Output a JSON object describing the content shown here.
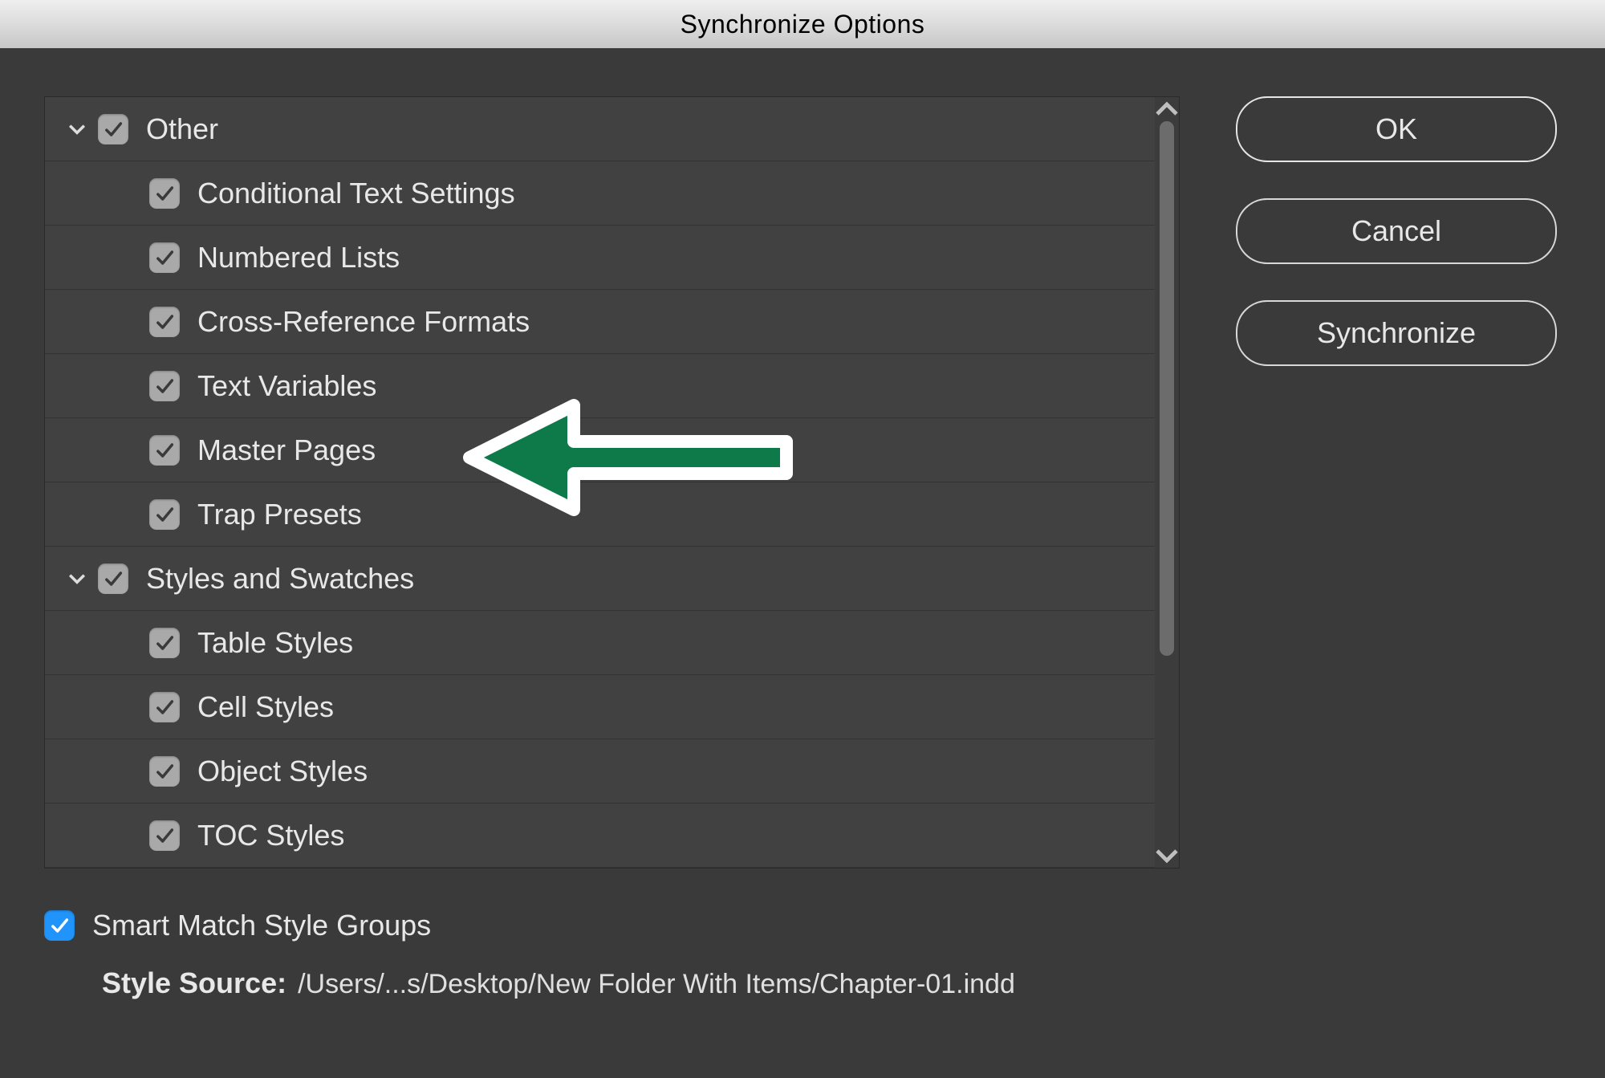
{
  "title": "Synchronize Options",
  "buttons": {
    "ok": "OK",
    "cancel": "Cancel",
    "sync": "Synchronize"
  },
  "groups": [
    {
      "label": "Other",
      "checked": true,
      "items": [
        {
          "label": "Conditional Text Settings",
          "checked": true
        },
        {
          "label": "Numbered Lists",
          "checked": true
        },
        {
          "label": "Cross-Reference Formats",
          "checked": true
        },
        {
          "label": "Text Variables",
          "checked": true
        },
        {
          "label": "Master Pages",
          "checked": true,
          "highlight": true
        },
        {
          "label": "Trap Presets",
          "checked": true
        }
      ]
    },
    {
      "label": "Styles and Swatches",
      "checked": true,
      "items": [
        {
          "label": "Table Styles",
          "checked": true
        },
        {
          "label": "Cell Styles",
          "checked": true
        },
        {
          "label": "Object Styles",
          "checked": true
        },
        {
          "label": "TOC Styles",
          "checked": true
        }
      ]
    }
  ],
  "footer": {
    "smart_match_label": "Smart Match Style Groups",
    "smart_match_checked": true,
    "style_source_label": "Style Source:",
    "style_source_path": "/Users/...s/Desktop/New Folder With Items/Chapter-01.indd"
  }
}
